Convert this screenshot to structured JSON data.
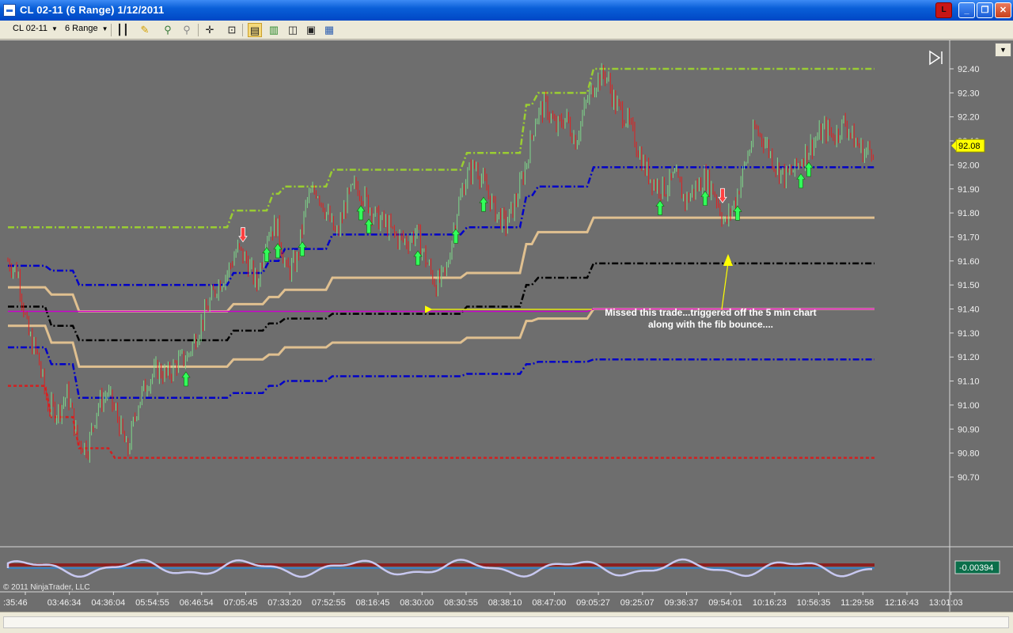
{
  "window": {
    "title": "CL 02-11 (6 Range)  1/12/2011",
    "link_button": "L"
  },
  "toolbar": {
    "instrument": "CL 02-11",
    "period": "6 Range"
  },
  "chart_data": {
    "type": "candlestick",
    "y_axis": {
      "ylim": [
        90.67,
        92.45
      ],
      "tick_labels": [
        "92.40",
        "92.30",
        "92.20",
        "92.10",
        "92.00",
        "91.90",
        "91.80",
        "91.70",
        "91.60",
        "91.50",
        "91.40",
        "91.30",
        "91.20",
        "91.10",
        "91.00",
        "90.90",
        "90.80",
        "90.70"
      ],
      "current_price": "92.08"
    },
    "x_axis": {
      "tick_labels": [
        ":35:46",
        "03:46:34",
        "04:36:04",
        "05:54:55",
        "06:46:54",
        "07:05:45",
        "07:33:20",
        "07:52:55",
        "08:16:45",
        "08:30:00",
        "08:30:55",
        "08:38:10",
        "08:47:00",
        "09:05:27",
        "09:25:07",
        "09:36:37",
        "09:54:01",
        "10:16:23",
        "10:56:35",
        "11:29:58",
        "12:16:43",
        "13:01:03"
      ]
    },
    "price_path": [
      91.6,
      91.55,
      91.3,
      91.2,
      91.0,
      90.97,
      91.05,
      90.85,
      90.82,
      91.0,
      91.05,
      90.95,
      90.8,
      91.0,
      91.1,
      91.15,
      91.12,
      91.18,
      91.2,
      91.3,
      91.4,
      91.5,
      91.55,
      91.65,
      91.6,
      91.5,
      91.72,
      91.75,
      91.55,
      91.6,
      91.85,
      91.9,
      91.8,
      91.7,
      91.85,
      91.92,
      91.85,
      91.78,
      91.75,
      91.7,
      91.68,
      91.72,
      91.6,
      91.5,
      91.55,
      91.8,
      91.95,
      92.0,
      91.9,
      91.8,
      91.75,
      91.85,
      92.0,
      92.2,
      92.25,
      92.15,
      92.2,
      92.1,
      92.25,
      92.35,
      92.38,
      92.25,
      92.2,
      92.1,
      91.98,
      91.92,
      91.9,
      91.95,
      91.85,
      91.9,
      91.95,
      91.88,
      91.75,
      91.85,
      92.0,
      92.15,
      92.1,
      92.0,
      91.95,
      91.98,
      92.05,
      92.1,
      92.15,
      92.12,
      92.18,
      92.1,
      92.05,
      92.08
    ],
    "horizontal_levels": [
      {
        "color": "#9acd32",
        "style": "dashdot",
        "steps": [
          [
            0,
            91.74
          ],
          [
            285,
            91.81
          ],
          [
            335,
            91.88
          ],
          [
            350,
            91.91
          ],
          [
            410,
            91.98
          ],
          [
            580,
            92.05
          ],
          [
            655,
            92.25
          ],
          [
            670,
            92.3
          ],
          [
            740,
            92.4
          ]
        ]
      },
      {
        "color": "#0000c8",
        "style": "dashdot",
        "steps": [
          [
            0,
            91.58
          ],
          [
            55,
            91.56
          ],
          [
            90,
            91.5
          ],
          [
            285,
            91.55
          ],
          [
            330,
            91.6
          ],
          [
            350,
            91.65
          ],
          [
            410,
            91.71
          ],
          [
            580,
            91.74
          ],
          [
            655,
            91.87
          ],
          [
            670,
            91.91
          ],
          [
            740,
            91.99
          ]
        ]
      },
      {
        "color": "#e0c090",
        "style": "solid",
        "steps": [
          [
            0,
            91.49
          ],
          [
            55,
            91.46
          ],
          [
            90,
            91.39
          ],
          [
            285,
            91.42
          ],
          [
            330,
            91.45
          ],
          [
            350,
            91.48
          ],
          [
            410,
            91.53
          ],
          [
            580,
            91.55
          ],
          [
            655,
            91.67
          ],
          [
            670,
            91.72
          ],
          [
            740,
            91.78
          ]
        ]
      },
      {
        "color": "#000000",
        "style": "dashdot",
        "steps": [
          [
            0,
            91.41
          ],
          [
            55,
            91.33
          ],
          [
            90,
            91.27
          ],
          [
            285,
            91.31
          ],
          [
            330,
            91.34
          ],
          [
            350,
            91.36
          ],
          [
            410,
            91.38
          ],
          [
            580,
            91.41
          ],
          [
            655,
            91.5
          ],
          [
            670,
            91.53
          ],
          [
            740,
            91.59
          ]
        ]
      },
      {
        "color": "#e0c090",
        "style": "solid",
        "steps": [
          [
            0,
            91.33
          ],
          [
            55,
            91.26
          ],
          [
            90,
            91.16
          ],
          [
            285,
            91.19
          ],
          [
            330,
            91.21
          ],
          [
            350,
            91.24
          ],
          [
            410,
            91.26
          ],
          [
            580,
            91.28
          ],
          [
            655,
            91.35
          ],
          [
            670,
            91.36
          ],
          [
            740,
            91.4
          ]
        ]
      },
      {
        "color": "#0000c8",
        "style": "dashdot",
        "steps": [
          [
            0,
            91.24
          ],
          [
            55,
            91.17
          ],
          [
            90,
            91.03
          ],
          [
            285,
            91.05
          ],
          [
            330,
            91.08
          ],
          [
            350,
            91.1
          ],
          [
            410,
            91.12
          ],
          [
            580,
            91.13
          ],
          [
            655,
            91.17
          ],
          [
            670,
            91.18
          ],
          [
            740,
            91.19
          ]
        ]
      },
      {
        "color": "#cc00cc",
        "style": "solid",
        "steps": [
          [
            0,
            91.39
          ],
          [
            740,
            91.4
          ]
        ]
      },
      {
        "color": "#d22020",
        "style": "dashed",
        "steps": [
          [
            0,
            91.08
          ],
          [
            55,
            90.95
          ],
          [
            90,
            90.82
          ],
          [
            135,
            90.78
          ]
        ]
      }
    ],
    "signals": {
      "buy_x": [
        235,
        337,
        351,
        382,
        456,
        466,
        528,
        576,
        611,
        834,
        891,
        932,
        1012,
        1022
      ],
      "sell_x": [
        307,
        913
      ]
    },
    "annotation": {
      "lines": [
        "Missed this trade...triggered off the 5 min chart",
        "along with the fib bounce...."
      ]
    },
    "oscillator": {
      "value_label": "-0.00394"
    }
  },
  "copyright": "© 2011 NinjaTrader, LLC"
}
